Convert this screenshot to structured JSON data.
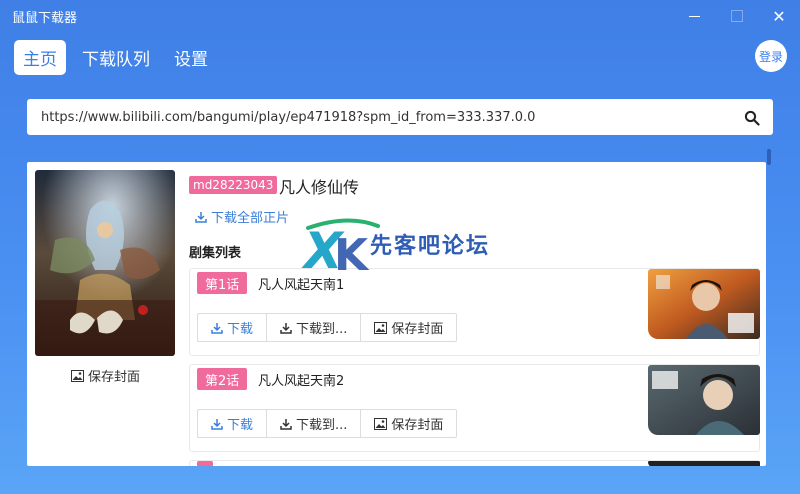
{
  "window": {
    "title": "鼠鼠下载器",
    "close_glyph": "✕"
  },
  "nav": {
    "tabs": [
      {
        "label": "主页",
        "active": true
      },
      {
        "label": "下载队列",
        "active": false
      },
      {
        "label": "设置",
        "active": false
      }
    ],
    "login_label": "登录"
  },
  "search": {
    "value": "https://www.bilibili.com/bangumi/play/ep471918?spm_id_from=333.337.0.0",
    "icon": "search-icon"
  },
  "media": {
    "id_badge": "md28223043",
    "title": "凡人修仙传",
    "download_all_label": "下载全部正片",
    "save_cover_label": "保存封面",
    "episode_list_heading": "剧集列表"
  },
  "episodes": [
    {
      "badge": "第1话",
      "title": "凡人风起天南1",
      "download_label": "下载",
      "download_to_label": "下载到...",
      "save_cover_label": "保存封面"
    },
    {
      "badge": "第2话",
      "title": "凡人风起天南2",
      "download_label": "下载",
      "download_to_label": "下载到...",
      "save_cover_label": "保存封面"
    }
  ],
  "watermark": {
    "logo": "XK",
    "text": "先客吧论坛"
  },
  "colors": {
    "accent": "#3a7ee8",
    "badge_pink": "#f06a9c",
    "link_blue": "#3b7ed8"
  }
}
